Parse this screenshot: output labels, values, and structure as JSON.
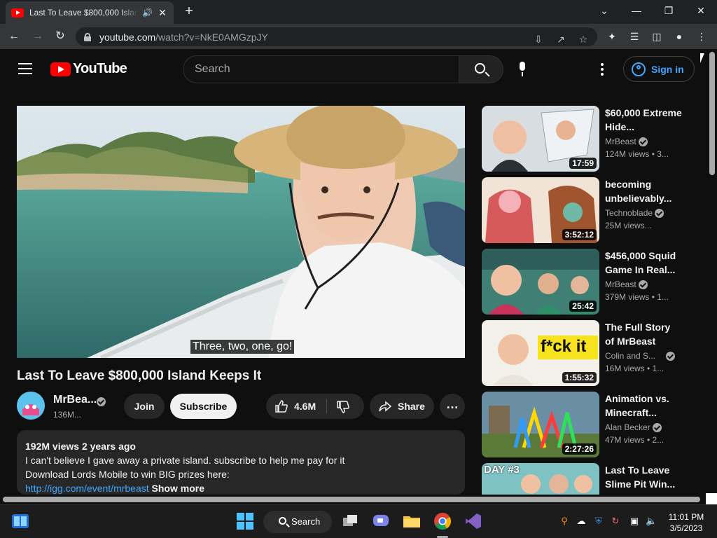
{
  "browser": {
    "tab_title": "Last To Leave $800,000 Island Keeps It",
    "url_host": "youtube.com",
    "url_path": "/watch?v=NkE0AMGzpJY"
  },
  "header": {
    "logo_text": "YouTube",
    "search_placeholder": "Search",
    "sign_in": "Sign in"
  },
  "video": {
    "caption": "Three, two, one, go!",
    "title": "Last To Leave $800,000 Island Keeps It",
    "channel": "MrBea...",
    "subscribers": "136M...",
    "join": "Join",
    "subscribe": "Subscribe",
    "likes": "4.6M",
    "share": "Share",
    "more": "…",
    "description": {
      "meta": "192M views  2 years ago",
      "line1": "I can't believe I gave away a private island. subscribe to help me pay for it",
      "line2": "Download Lords Mobile to win BIG prizes here:",
      "link": "http://igg.com/event/mrbeast",
      "show_more": "Show more"
    }
  },
  "recommendations": [
    {
      "title": "$60,000 Extreme Hide...",
      "channel": "MrBeast",
      "views": "124M views  • 3...",
      "duration": "17:59"
    },
    {
      "title": "becoming unbelievably...",
      "channel": "Technoblade",
      "views": "25M views...",
      "duration": "3:52:12"
    },
    {
      "title": "$456,000 Squid Game In Real...",
      "channel": "MrBeast",
      "views": "379M views  • 1...",
      "duration": "25:42"
    },
    {
      "title": "The Full Story of MrBeast",
      "channel": "Colin and S...",
      "views": "16M views  • 1...",
      "duration": "1:55:32",
      "thumb_text": "f*ck it"
    },
    {
      "title": "Animation vs. Minecraft...",
      "channel": "Alan Becker",
      "views": "47M views  • 2...",
      "duration": "2:27:26"
    },
    {
      "title": "Last To Leave Slime Pit Win...",
      "thumb_text": "DAY #3"
    }
  ],
  "taskbar": {
    "search": "Search",
    "time": "11:01 PM",
    "date": "3/5/2023"
  },
  "colors": {
    "youtube_red": "#ff0000",
    "link_blue": "#3ea6ff",
    "background": "#0f0f0f"
  },
  "icons": [
    "youtube-favicon",
    "audio-icon",
    "close-icon",
    "plus-icon",
    "back-icon",
    "forward-icon",
    "reload-icon",
    "lock-icon",
    "install-icon",
    "share-icon",
    "star-icon",
    "extensions-icon",
    "media-icon",
    "sidepanel-icon",
    "profile-icon",
    "menu-icon",
    "search-icon",
    "mic-icon",
    "more-icon",
    "user-icon",
    "verified-icon",
    "like-icon",
    "dislike-icon",
    "share-arrow-icon"
  ]
}
